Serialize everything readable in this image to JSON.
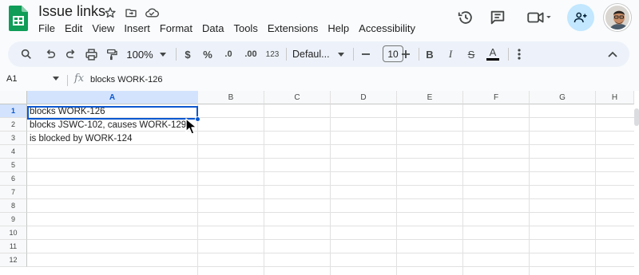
{
  "document": {
    "title": "Issue links"
  },
  "menu": [
    "File",
    "Edit",
    "View",
    "Insert",
    "Format",
    "Data",
    "Tools",
    "Extensions",
    "Help",
    "Accessibility"
  ],
  "toolbar": {
    "zoom": "100%",
    "currency": "$",
    "percent": "%",
    "decrease_decimal": ".0",
    "increase_decimal": ".00",
    "number_format": "123",
    "font": "Defaul...",
    "font_size": "10",
    "bold": "B",
    "italic": "I",
    "strike": "S",
    "text_color": "A"
  },
  "formula_bar": {
    "cell_ref": "A1",
    "fx": "fx",
    "content": "blocks WORK-126"
  },
  "grid": {
    "columns": [
      "A",
      "B",
      "C",
      "D",
      "E",
      "F",
      "G",
      "H"
    ],
    "rows": [
      "1",
      "2",
      "3",
      "4",
      "5",
      "6",
      "7",
      "8",
      "9",
      "10",
      "11",
      "12"
    ],
    "cells": [
      {
        "ref": "A1",
        "value": "blocks WORK-126"
      },
      {
        "ref": "A2",
        "value": "blocks JSWC-102, causes WORK-129"
      },
      {
        "ref": "A3",
        "value": "is blocked by WORK-124"
      }
    ],
    "selected": "A1"
  },
  "colors": {
    "accent": "#0b57d0",
    "share_bg": "#c2e7ff",
    "toolbar_bg": "#edf2fa",
    "sheets_green": "#0f9d58"
  },
  "icons": [
    "sheets-logo-icon",
    "star-icon",
    "move-to-folder-icon",
    "cloud-saved-icon",
    "history-icon",
    "comment-icon",
    "video-call-icon",
    "share-person-icon",
    "search-icon",
    "undo-icon",
    "redo-icon",
    "print-icon",
    "paint-format-icon",
    "more-icon",
    "collapse-chevron-icon"
  ]
}
